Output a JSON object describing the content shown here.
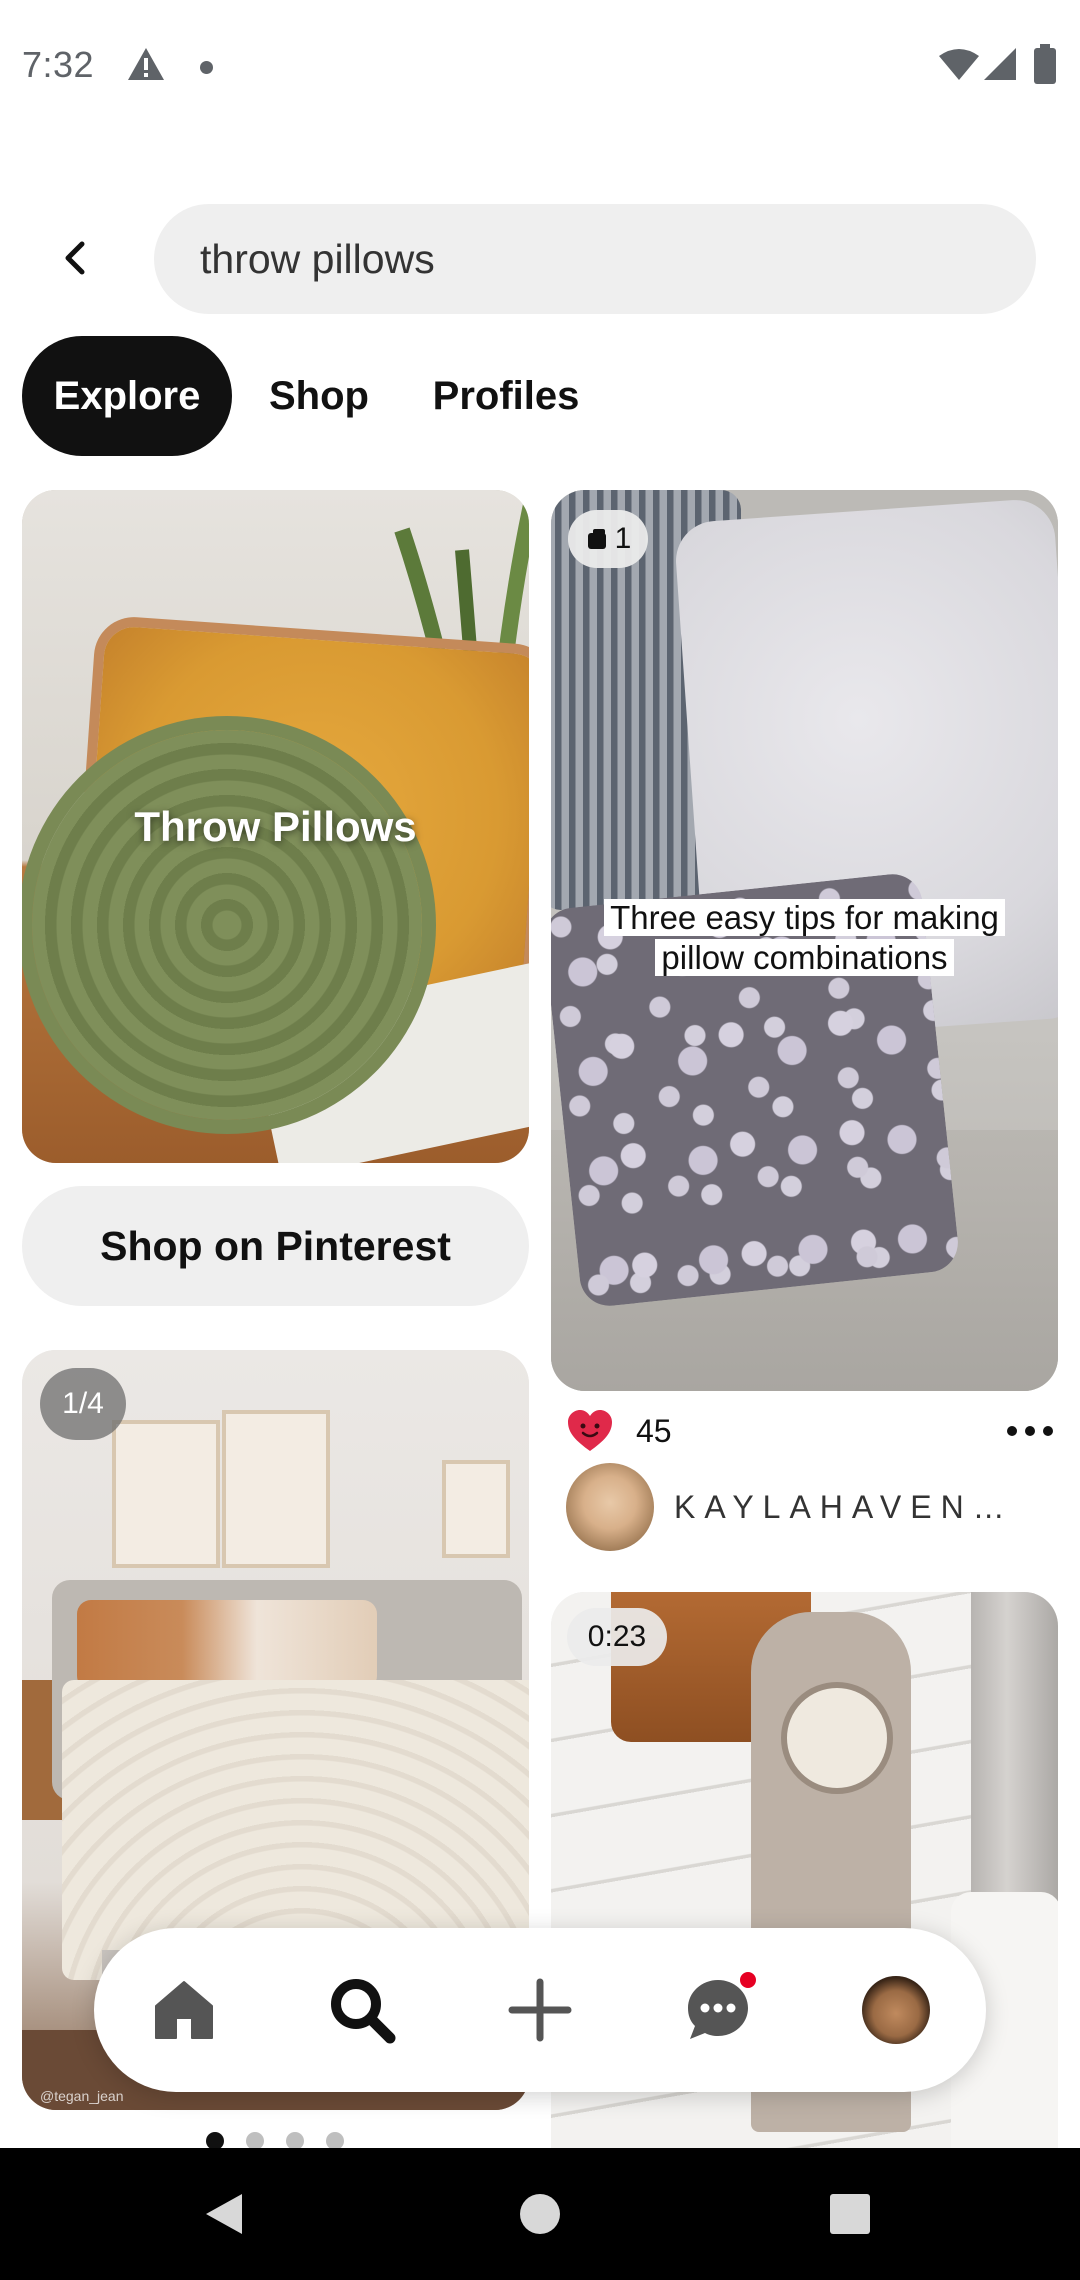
{
  "status_bar": {
    "time": "7:32"
  },
  "search": {
    "query": "throw pillows"
  },
  "tabs": [
    {
      "label": "Explore",
      "active": true
    },
    {
      "label": "Shop",
      "active": false
    },
    {
      "label": "Profiles",
      "active": false
    }
  ],
  "pins": {
    "throw_pillows_board": {
      "title": "Throw Pillows"
    },
    "shop_button_label": "Shop on Pinterest",
    "bedroom_pin": {
      "page_indicator": "1/4",
      "watermark": "@tegan_jean",
      "carousel_pages": 4,
      "carousel_active_index": 0
    },
    "tips_pin": {
      "item_count": "1",
      "caption_line1": "Three easy tips for making",
      "caption_line2": "pillow combinations",
      "reaction_count": "45",
      "creator_name": "KAYLAHAVEN…"
    },
    "clock_pin": {
      "duration": "0:23"
    }
  },
  "bottom_nav": {
    "items": [
      "home-icon",
      "search-icon",
      "add-icon",
      "messages-icon",
      "profile-avatar"
    ],
    "active": "search",
    "messages_has_notification": true
  },
  "colors": {
    "accent_red": "#e60023",
    "active_tab_bg": "#111111",
    "pill_bg": "#efefef"
  }
}
